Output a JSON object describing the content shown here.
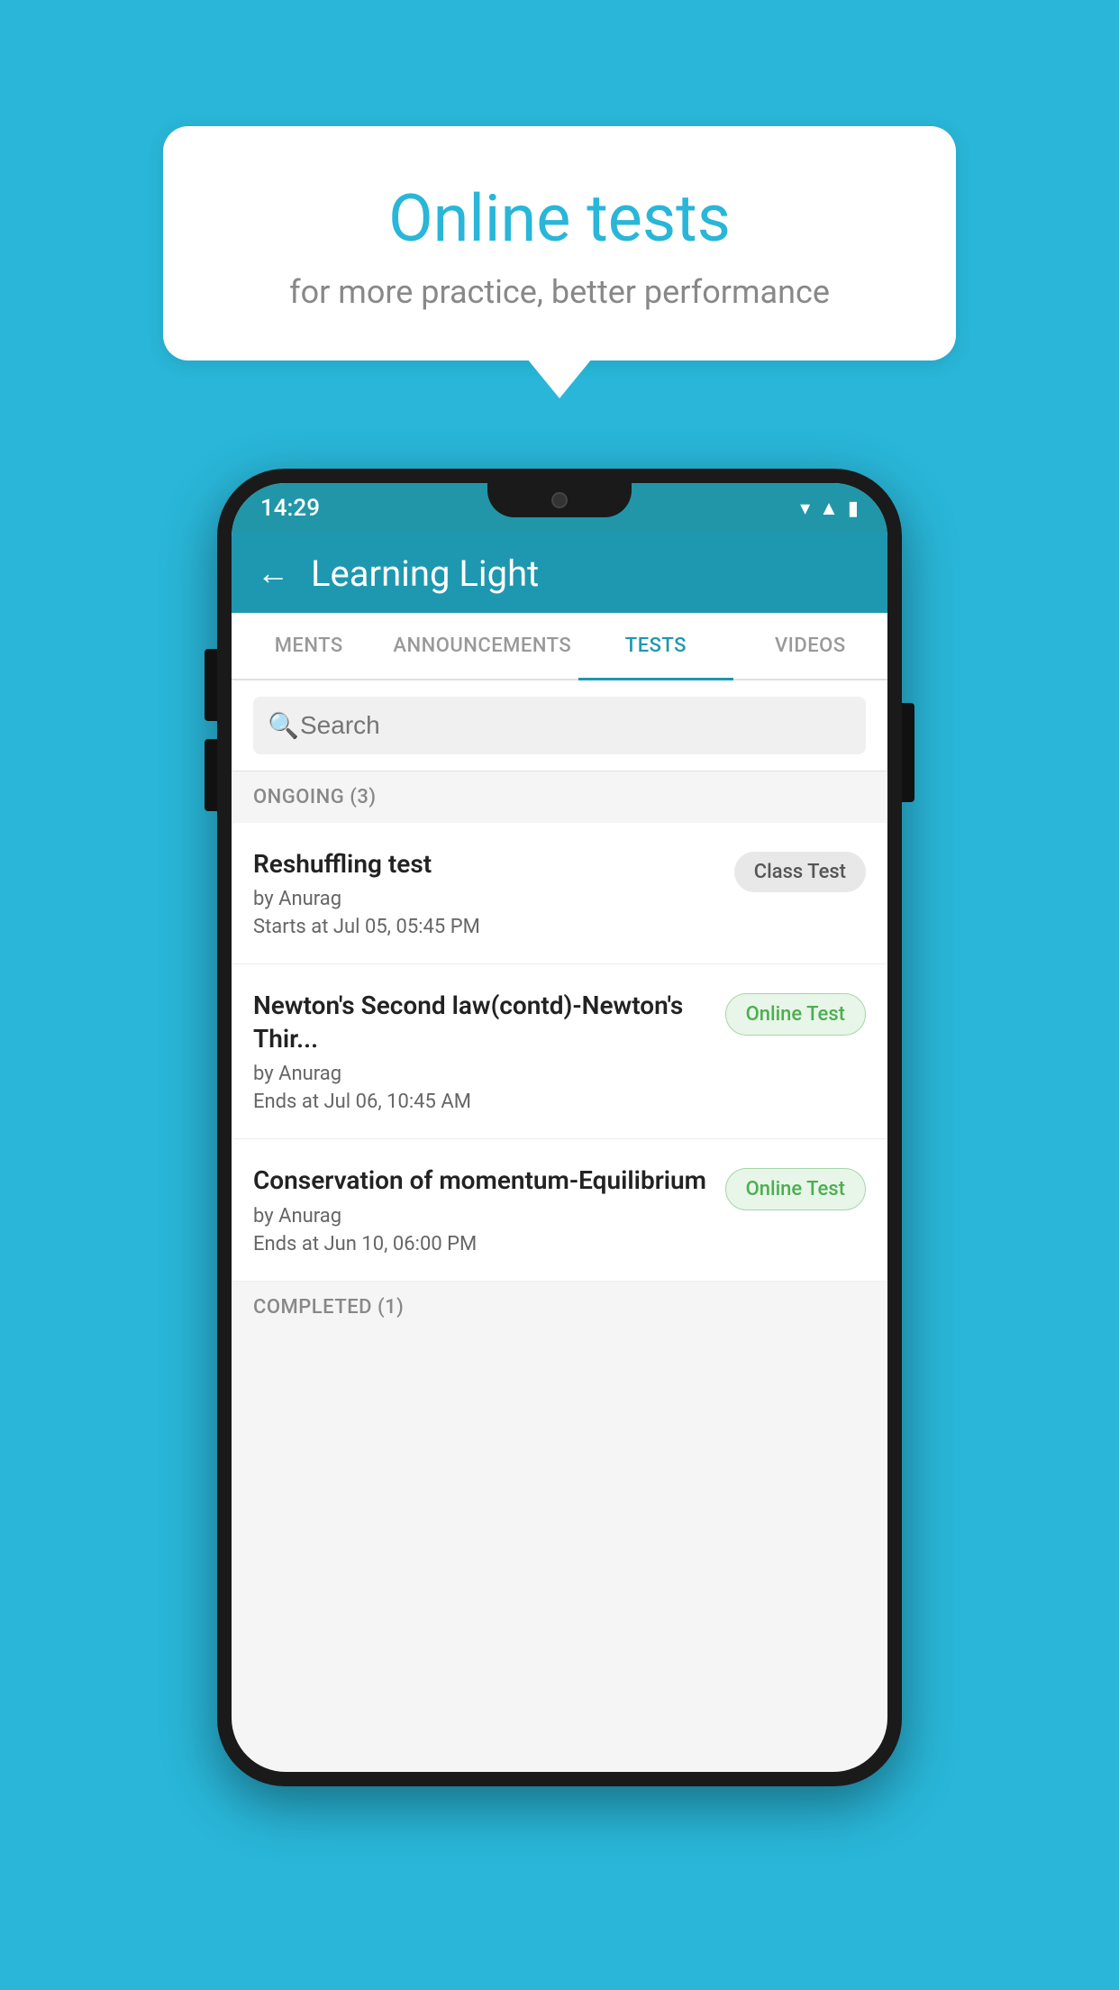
{
  "background_color": "#29b6d8",
  "bubble": {
    "title": "Online tests",
    "subtitle": "for more practice, better performance"
  },
  "phone": {
    "status_bar": {
      "time": "14:29",
      "icons": [
        "wifi",
        "signal",
        "battery"
      ]
    },
    "header": {
      "title": "Learning Light",
      "back_label": "←"
    },
    "tabs": [
      {
        "label": "MENTS",
        "active": false
      },
      {
        "label": "ANNOUNCEMENTS",
        "active": false
      },
      {
        "label": "TESTS",
        "active": true
      },
      {
        "label": "VIDEOS",
        "active": false
      }
    ],
    "search": {
      "placeholder": "Search"
    },
    "ongoing_section": {
      "label": "ONGOING (3)"
    },
    "tests": [
      {
        "name": "Reshuffling test",
        "author": "by Anurag",
        "time_label": "Starts at",
        "time_value": "Jul 05, 05:45 PM",
        "badge": "Class Test",
        "badge_type": "class"
      },
      {
        "name": "Newton's Second law(contd)-Newton's Thir...",
        "author": "by Anurag",
        "time_label": "Ends at",
        "time_value": "Jul 06, 10:45 AM",
        "badge": "Online Test",
        "badge_type": "online"
      },
      {
        "name": "Conservation of momentum-Equilibrium",
        "author": "by Anurag",
        "time_label": "Ends at",
        "time_value": "Jun 10, 06:00 PM",
        "badge": "Online Test",
        "badge_type": "online"
      }
    ],
    "completed_section": {
      "label": "COMPLETED (1)"
    }
  }
}
